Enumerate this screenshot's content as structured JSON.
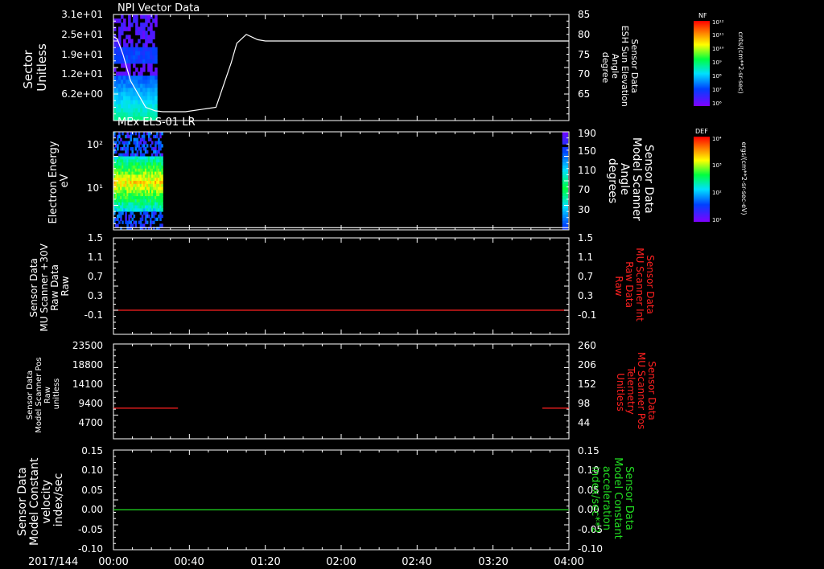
{
  "date_label": "2017/144",
  "time_ticks": [
    "00:00",
    "00:40",
    "01:20",
    "02:00",
    "02:40",
    "03:20",
    "04:00"
  ],
  "chart_data": [
    {
      "type": "heatmap",
      "title": "NPI Vector Data",
      "left_axis": {
        "label": [
          "Sector",
          "Unitless"
        ],
        "ticks": [
          "3.1e+01",
          "2.5e+01",
          "1.9e+01",
          "1.2e+01",
          "6.2e+00"
        ]
      },
      "right_axis": {
        "label": [
          "Sensor Data",
          "ESH Sun Elevation",
          "Angle",
          "degree"
        ],
        "ticks": [
          "85",
          "80",
          "75",
          "70",
          "65"
        ],
        "ylim": [
          61,
          85
        ]
      },
      "line_series": {
        "color": "#ffffff",
        "x": [
          0,
          2,
          5,
          9,
          17,
          22,
          26,
          31,
          38,
          54,
          62,
          65,
          70,
          76,
          80,
          240
        ],
        "y": [
          80,
          79.5,
          76,
          70,
          64,
          63.2,
          63,
          63,
          63,
          64,
          74,
          78.5,
          80.5,
          79.3,
          79,
          79
        ]
      },
      "colorbar": {
        "title": "NF",
        "label": "cnts/(cm**2-sr-sec)",
        "ticks": [
          "10¹²",
          "10¹¹",
          "10¹⁰",
          "10⁹",
          "10⁸",
          "10⁷",
          "10⁶"
        ]
      }
    },
    {
      "type": "heatmap",
      "title": "MEx ELS-01 LR",
      "left_axis": {
        "label": [
          "Electron Energy",
          "eV"
        ],
        "ticks": [
          "10²",
          "10¹"
        ]
      },
      "right_axis": {
        "label": [
          "Sensor Data",
          "Model Scanner",
          "Angle",
          "degrees"
        ],
        "ticks": [
          "190",
          "150",
          "110",
          "70",
          "30"
        ],
        "ylim": [
          10,
          190
        ]
      },
      "line_series": {
        "color": "#ffffff",
        "x": [
          0,
          240
        ],
        "y": [
          14,
          14
        ]
      },
      "colorbar": {
        "title": "DEF",
        "label": "ergs/(cm**2-sr-sec-eV)",
        "ticks": [
          "10⁴",
          "10³",
          "10²",
          "10¹"
        ]
      }
    },
    {
      "type": "line",
      "left_axis": {
        "label": [
          "Sensor Data",
          "MU Scanner +30V",
          "Raw Data",
          "Raw"
        ],
        "ticks": [
          "1.5",
          "1.1",
          "0.7",
          "0.3",
          "-0.1"
        ],
        "ylim": [
          -0.5,
          1.5
        ]
      },
      "right_axis": {
        "label": [
          "Sensor Data",
          "MU Scanner Int",
          "Raw Data",
          "Raw"
        ],
        "ticks": [
          "1.5",
          "1.1",
          "0.7",
          "0.3",
          "-0.1"
        ],
        "color": "#ff2020"
      },
      "series": [
        {
          "color": "#ff2020",
          "segments": [
            {
              "x": [
                0,
                240
              ],
              "y": [
                0,
                0
              ]
            }
          ]
        }
      ]
    },
    {
      "type": "line",
      "left_axis": {
        "label": [
          "Sensor Data",
          "Model Scanner Pos",
          "Raw",
          "unitless"
        ],
        "ticks": [
          "23500",
          "18800",
          "14100",
          "9400",
          "4700"
        ],
        "ylim": [
          0,
          23500
        ]
      },
      "right_axis": {
        "label": [
          "Sensor Data",
          "MU Scanner Pos",
          "Telemetry",
          "Unitless"
        ],
        "ticks": [
          "260",
          "206",
          "152",
          "98",
          "44"
        ],
        "ylim": [
          0,
          260
        ],
        "color": "#ff2020"
      },
      "series": [
        {
          "color": "#ff2020",
          "segments": [
            {
              "x": [
                0,
                34
              ],
              "y": [
                84,
                84
              ]
            },
            {
              "x": [
                226,
                240
              ],
              "y": [
                84,
                84
              ]
            }
          ]
        }
      ]
    },
    {
      "type": "line",
      "left_axis": {
        "label": [
          "Sensor Data",
          "Model Constant",
          "velocity",
          "index/sec"
        ],
        "ticks": [
          "0.15",
          "0.10",
          "0.05",
          "0.00",
          "-0.05",
          "-0.10"
        ],
        "ylim": [
          -0.1,
          0.15
        ]
      },
      "right_axis": {
        "label": [
          "Sensor Data",
          "Model Constant",
          "acceleration",
          "index/sec**2"
        ],
        "ticks": [
          "0.15",
          "0.10",
          "0.05",
          "0.00",
          "-0.05",
          "-0.10"
        ],
        "color": "#22dd22"
      },
      "series": [
        {
          "color": "#22dd22",
          "segments": [
            {
              "x": [
                0,
                240
              ],
              "y": [
                0,
                0
              ]
            }
          ]
        }
      ]
    }
  ]
}
